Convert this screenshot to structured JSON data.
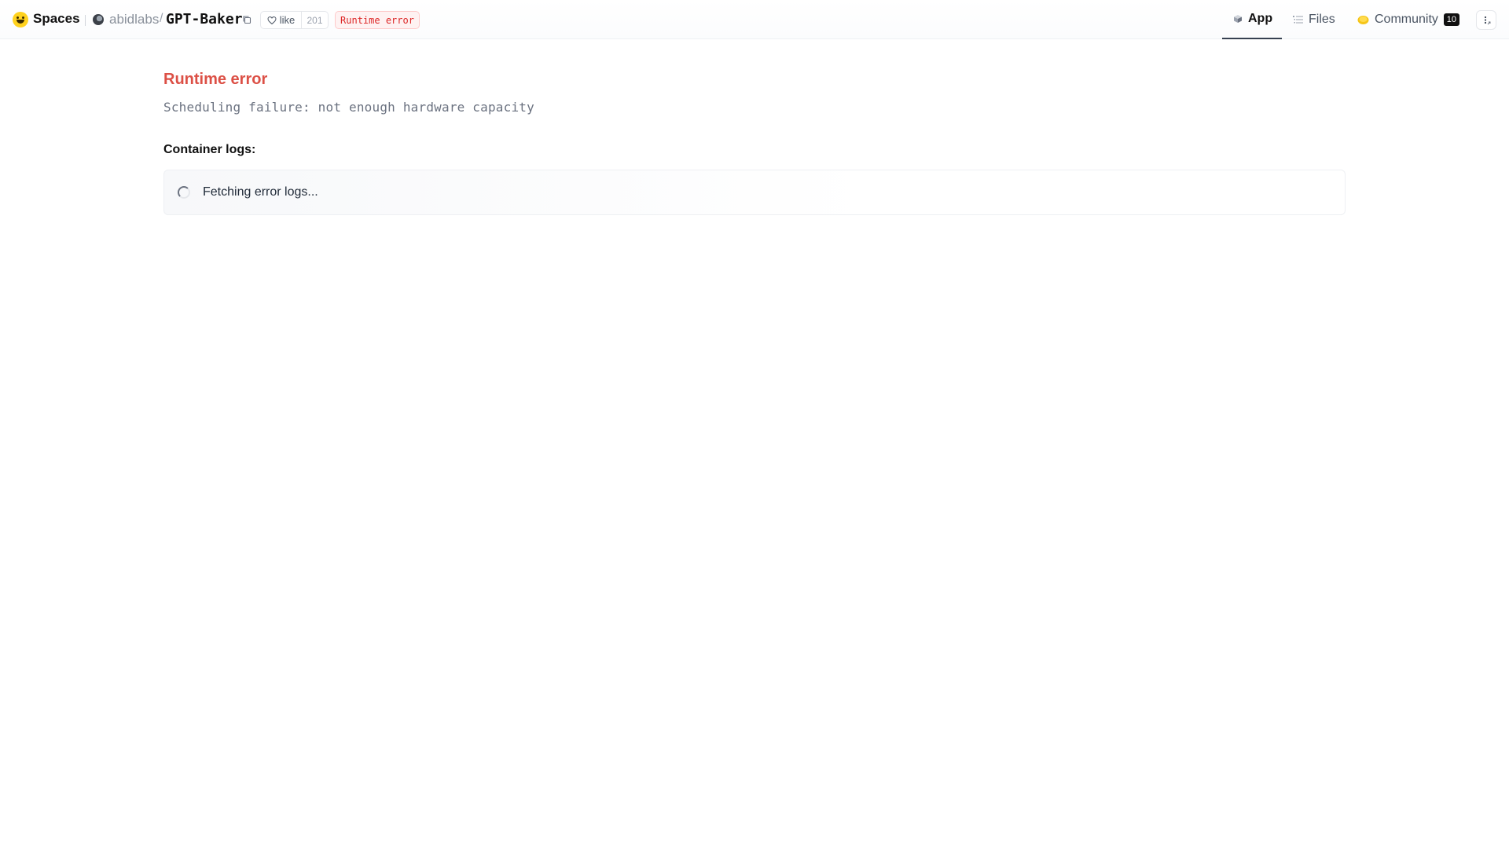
{
  "header": {
    "brand": "Spaces",
    "owner": "abidlabs",
    "separator": "/",
    "repo": "GPT-Baker",
    "like_label": "like",
    "like_count": "201",
    "status_badge": "Runtime error"
  },
  "tabs": [
    {
      "label": "App",
      "icon": "cube-icon",
      "active": true
    },
    {
      "label": "Files",
      "icon": "files-icon",
      "active": false
    },
    {
      "label": "Community",
      "icon": "community-icon",
      "active": false,
      "count": "10"
    }
  ],
  "main": {
    "error_title": "Runtime error",
    "error_detail": "Scheduling failure: not enough hardware capacity",
    "logs_label": "Container logs:",
    "logs_status": "Fetching error logs..."
  },
  "colors": {
    "error": "#dc5046",
    "badge_red": "#dc2626",
    "hf_yellow": "#ffd21e"
  }
}
